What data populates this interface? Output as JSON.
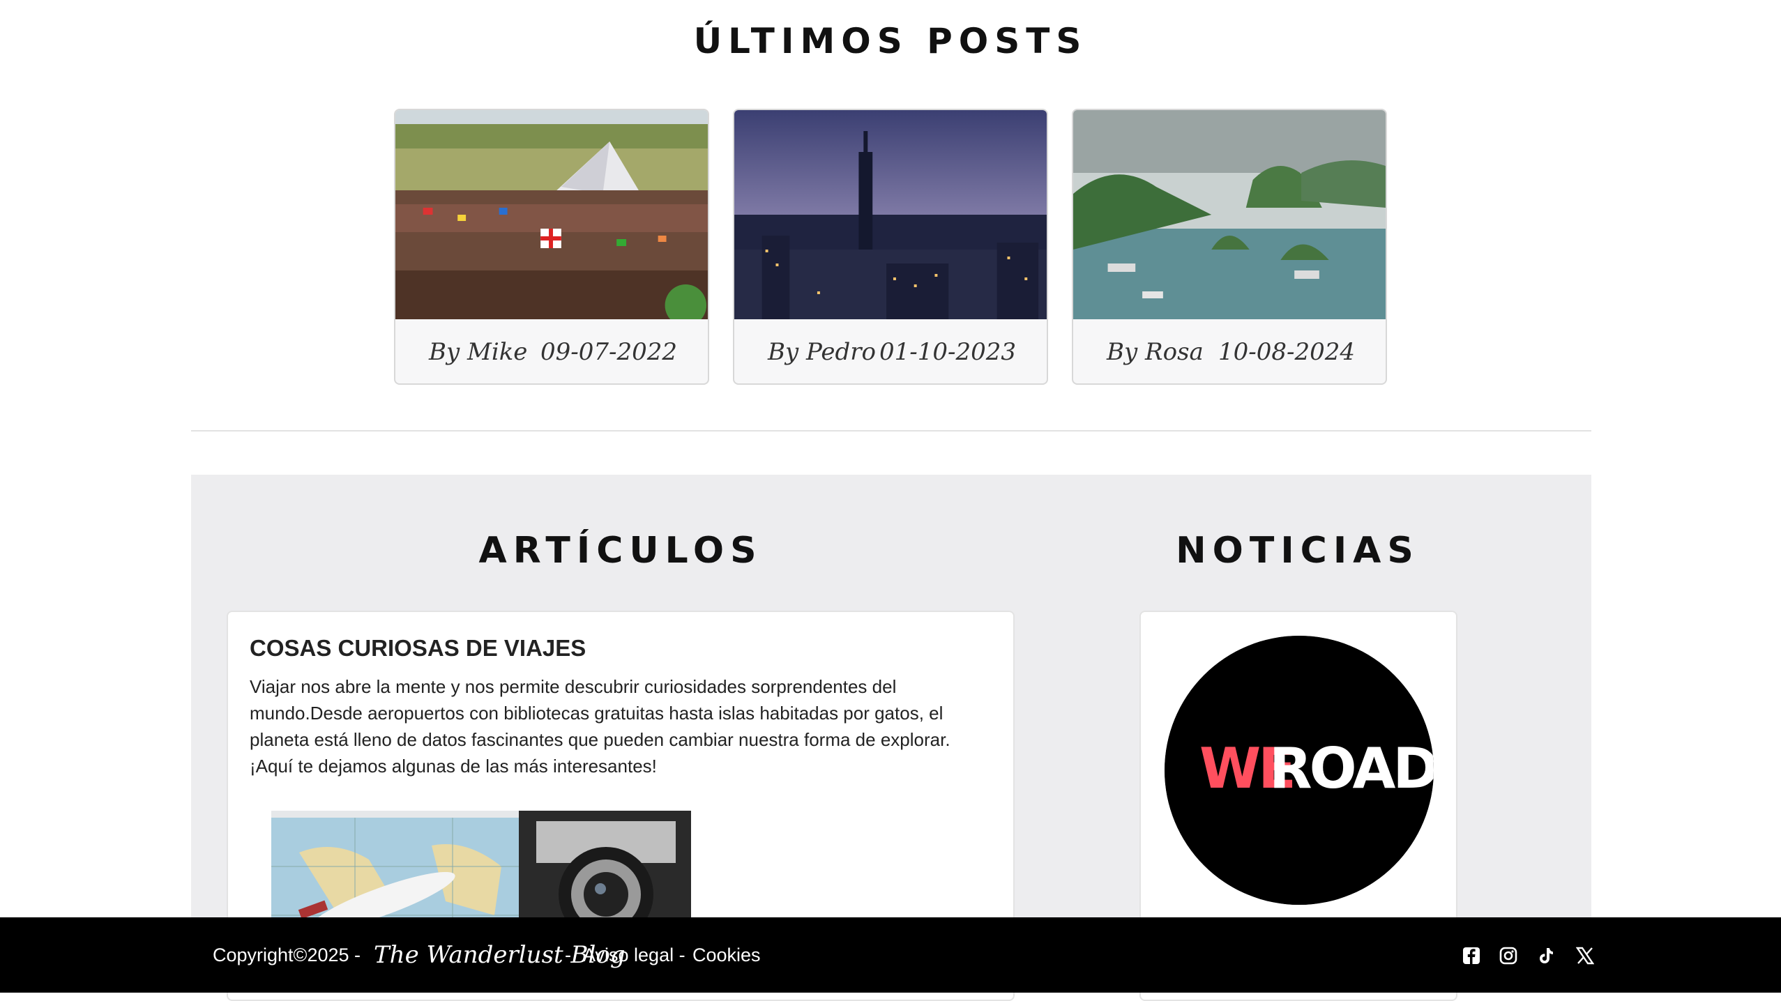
{
  "latest": {
    "title": "ÚLTIMOS POSTS",
    "posts": [
      {
        "author": "By Mike",
        "date": "09-07-2022",
        "image": "festival-crowd-pyramid-stage"
      },
      {
        "author": "By Pedro",
        "date": "01-10-2023",
        "image": "new-york-skyline-sunset"
      },
      {
        "author": "By Rosa",
        "date": "10-08-2024",
        "image": "ha-long-bay-islands"
      }
    ]
  },
  "articles": {
    "title": "ARTÍCULOS",
    "items": [
      {
        "heading": "COSAS CURIOSAS DE VIAJES",
        "body": "Viajar nos abre la mente y nos permite descubrir curiosidades sorprendentes del mundo.Desde aeropuertos con bibliotecas gratuitas hasta islas habitadas por gatos, el planeta está lleno de datos fascinantes que pueden cambiar nuestra forma de explorar. ¡Aquí te dejamos algunas de las más interesantes!",
        "image": "toy-airplane-map-vintage-camera"
      }
    ]
  },
  "news": {
    "title": "NOTICIAS",
    "logo": {
      "text_we": "WE",
      "text_road": "ROAD",
      "we_color": "#ff4f5e",
      "road_color": "#ffffff",
      "bg_color": "#000000"
    }
  },
  "footer": {
    "copyright": "Copyright©2025 -",
    "blog_name": "The Wanderlust Blog",
    "separator": "-",
    "legal": "Aviso legal -",
    "cookies": "Cookies",
    "social_icons": [
      "facebook-icon",
      "instagram-icon",
      "tiktok-icon",
      "x-icon"
    ]
  },
  "colors": {
    "footer_bg": "#000000",
    "section_bg": "#ededef",
    "card_bg": "#f7f7f8"
  }
}
